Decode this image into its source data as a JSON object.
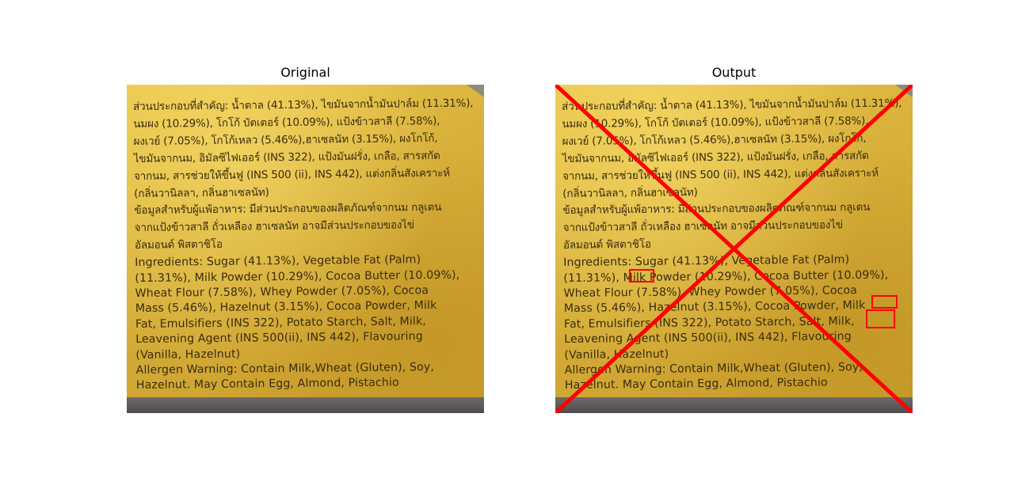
{
  "panels": {
    "left_title": "Original",
    "right_title": "Output"
  },
  "label_text": {
    "thai_lines": [
      "ส่วนประกอบที่สำคัญ: น้ำตาล (41.13%), ไขมันจากน้ำมันปาล์ม (11.31%),",
      "นมผง (10.29%), โกโก้ บัตเตอร์ (10.09%), แป้งข้าวสาลี (7.58%),",
      "ผงเวย์ (7.05%), โกโก้เหลว (5.46%),ฮาเซลนัท (3.15%), ผงโกโก้,",
      "ไขมันจากนม, อิมัลซิไฟเออร์ (INS 322), แป้งมันฝรั่ง, เกลือ, สารสกัด",
      "จากนม, สารช่วยให้ขึ้นฟู (INS 500 (ii), INS 442), แต่งกลิ่นสังเคราะห์",
      "(กลิ่นวานิลลา, กลิ่นฮาเซลนัท)",
      "ข้อมูลสำหรับผู้แพ้อาหาร: มีส่วนประกอบของผลิตภัณฑ์จากนม กลูเตน",
      "จากแป้งข้าวสาลี ถั่วเหลือง ฮาเซลนัท อาจมีส่วนประกอบของไข่",
      "อัลมอนด์ พิสตาชิโอ"
    ],
    "english_lines": [
      "Ingredients: Sugar (41.13%), Vegetable Fat (Palm)",
      "(11.31%), Milk Powder (10.29%), Cocoa Butter (10.09%),",
      "Wheat Flour (7.58%), Whey Powder (7.05%), Cocoa",
      "Mass (5.46%), Hazelnut (3.15%), Cocoa Powder, Milk",
      "Fat, Emulsifiers (INS 322), Potato Starch, Salt, Milk,",
      "Leavening Agent (INS 500(ii), INS 442), Flavouring",
      "(Vanilla, Hazelnut)",
      "Allergen Warning: Contain Milk,Wheat (Gluten), Soy,",
      "Hazelnut. May Contain Egg, Almond, Pistachio"
    ]
  },
  "overlay": {
    "cross_color": "#ff0000",
    "box_color": "#ff0000",
    "highlighted_words": [
      "Milk",
      "Milk",
      "Milk,"
    ]
  }
}
